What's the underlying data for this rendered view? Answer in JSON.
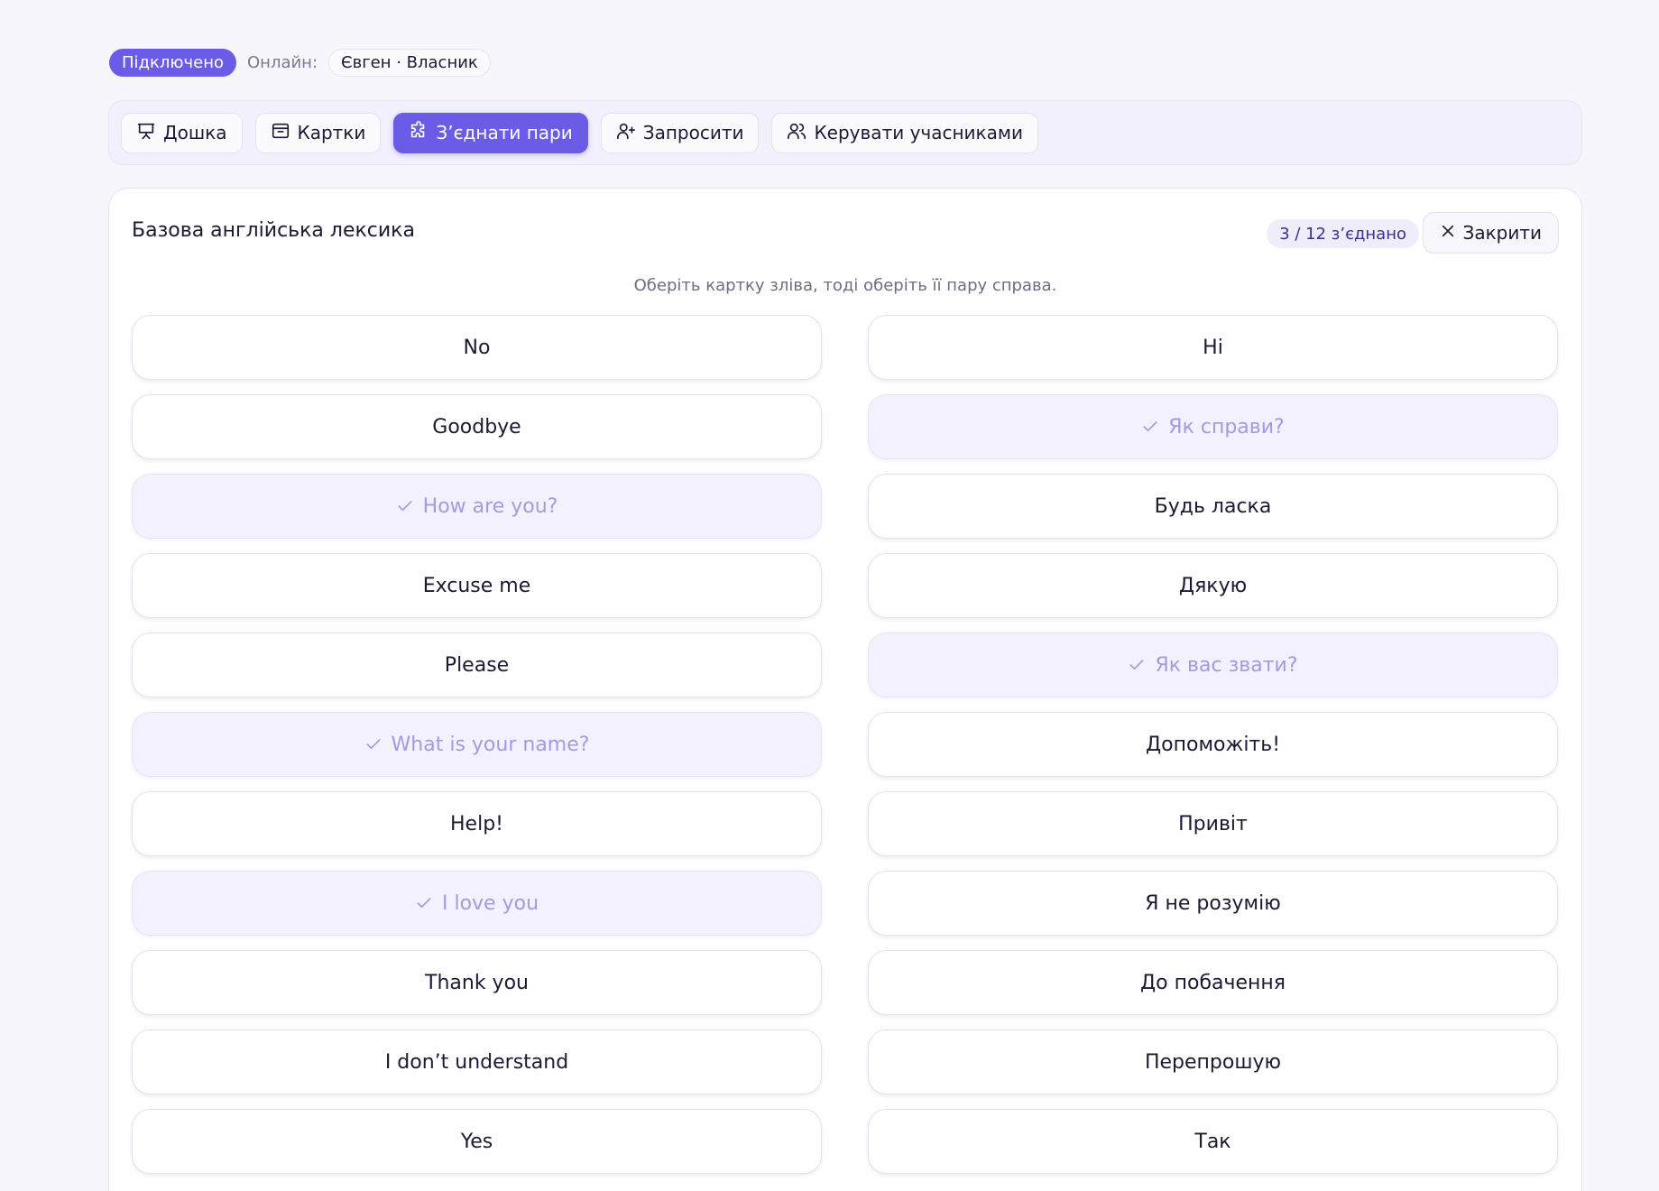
{
  "status": {
    "connected_label": "Підключено",
    "online_label": "Онлайн:",
    "online_user": "Євген · Власник"
  },
  "tabs": [
    {
      "label": "Дошка",
      "icon": "presentation-icon",
      "active": false
    },
    {
      "label": "Картки",
      "icon": "card-box-icon",
      "active": false
    },
    {
      "label": "З’єднати пари",
      "icon": "puzzle-icon",
      "active": true
    },
    {
      "label": "Запросити",
      "icon": "user-plus-icon",
      "active": false
    },
    {
      "label": "Керувати учасниками",
      "icon": "users-icon",
      "active": false
    }
  ],
  "panel": {
    "title": "Базова англійська лексика",
    "progress": "3 / 12 з’єднано",
    "close_label": "Закрити",
    "hint": "Оберіть картку зліва, тоді оберіть її пару справа."
  },
  "left_cards": [
    {
      "text": "No",
      "matched": false
    },
    {
      "text": "Goodbye",
      "matched": false
    },
    {
      "text": "How are you?",
      "matched": true
    },
    {
      "text": "Excuse me",
      "matched": false
    },
    {
      "text": "Please",
      "matched": false
    },
    {
      "text": "What is your name?",
      "matched": true
    },
    {
      "text": "Help!",
      "matched": false
    },
    {
      "text": "I love you",
      "matched": true
    },
    {
      "text": "Thank you",
      "matched": false
    },
    {
      "text": "I don’t understand",
      "matched": false
    },
    {
      "text": "Yes",
      "matched": false
    }
  ],
  "right_cards": [
    {
      "text": "Hi",
      "matched": false
    },
    {
      "text": "Як справи?",
      "matched": true
    },
    {
      "text": "Будь ласка",
      "matched": false
    },
    {
      "text": "Дякую",
      "matched": false
    },
    {
      "text": "Як вас звати?",
      "matched": true
    },
    {
      "text": "Допоможіть!",
      "matched": false
    },
    {
      "text": "Привіт",
      "matched": false
    },
    {
      "text": "Я не розумію",
      "matched": false
    },
    {
      "text": "До побачення",
      "matched": false
    },
    {
      "text": "Перепрошую",
      "matched": false
    },
    {
      "text": "Так",
      "matched": false
    }
  ],
  "colors": {
    "accent": "#6b5ce7",
    "matched_bg": "#f3f1fd",
    "matched_text": "#a49ae0"
  }
}
